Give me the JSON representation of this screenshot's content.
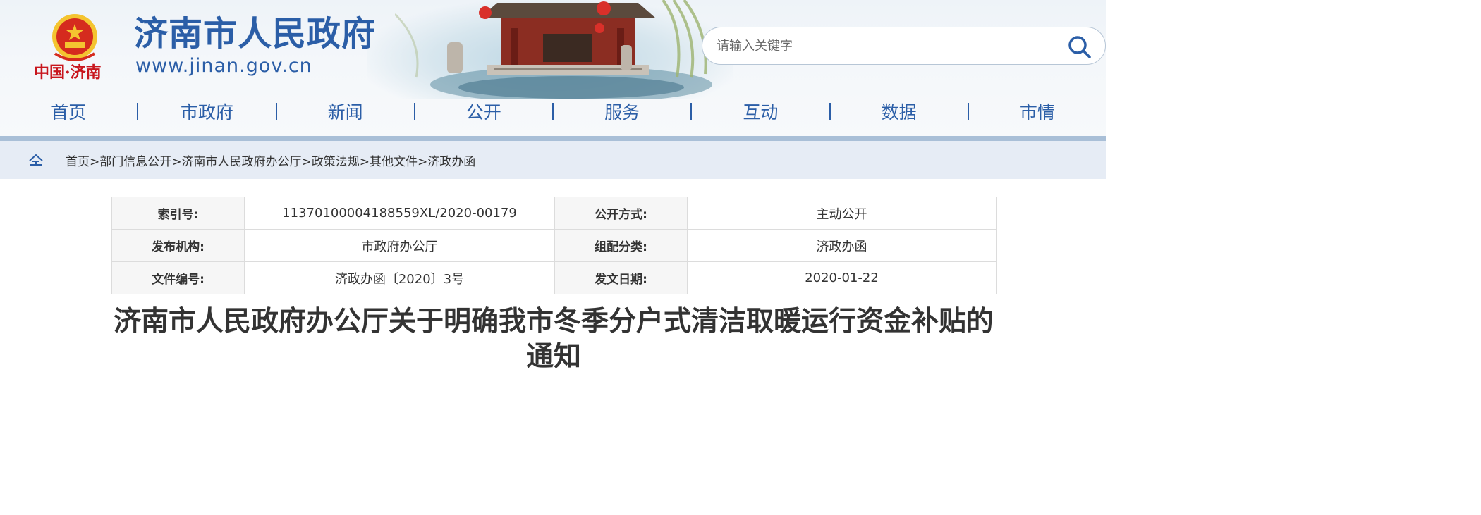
{
  "header": {
    "emblem_text": "中国·济南",
    "site_title": "济南市人民政府",
    "site_url": "www.jinan.gov.cn",
    "search": {
      "placeholder": "请输入关键字",
      "value": "",
      "icon": "search-icon"
    }
  },
  "nav": {
    "items": [
      {
        "label": "首页"
      },
      {
        "label": "市政府"
      },
      {
        "label": "新闻"
      },
      {
        "label": "公开"
      },
      {
        "label": "服务"
      },
      {
        "label": "互动"
      },
      {
        "label": "数据"
      },
      {
        "label": "市情"
      }
    ]
  },
  "breadcrumb": {
    "home_icon": "home-icon",
    "separator": ">",
    "items": [
      "首页",
      "部门信息公开",
      "济南市人民政府办公厅",
      "政策法规",
      "其他文件",
      "济政办函"
    ]
  },
  "meta": {
    "rows": [
      {
        "k1": "索引号:",
        "v1": "11370100004188559XL/2020-00179",
        "k2": "公开方式:",
        "v2": "主动公开"
      },
      {
        "k1": "发布机构:",
        "v1": "市政府办公厅",
        "k2": "组配分类:",
        "v2": "济政办函"
      },
      {
        "k1": "文件编号:",
        "v1": "济政办函〔2020〕3号",
        "k2": "发文日期:",
        "v2": "2020-01-22"
      }
    ]
  },
  "document": {
    "title_line1": "济南市人民政府办公厅关于明确我市冬季分户式清洁取暖运行资金补贴的",
    "title_line2": "通知"
  },
  "colors": {
    "brand_blue": "#2b5ea7",
    "breadcrumb_bg": "#e6ecf5",
    "header_bar": "#a9bfd7",
    "emblem_red": "#d52b1e",
    "emblem_gold": "#f4c430"
  }
}
